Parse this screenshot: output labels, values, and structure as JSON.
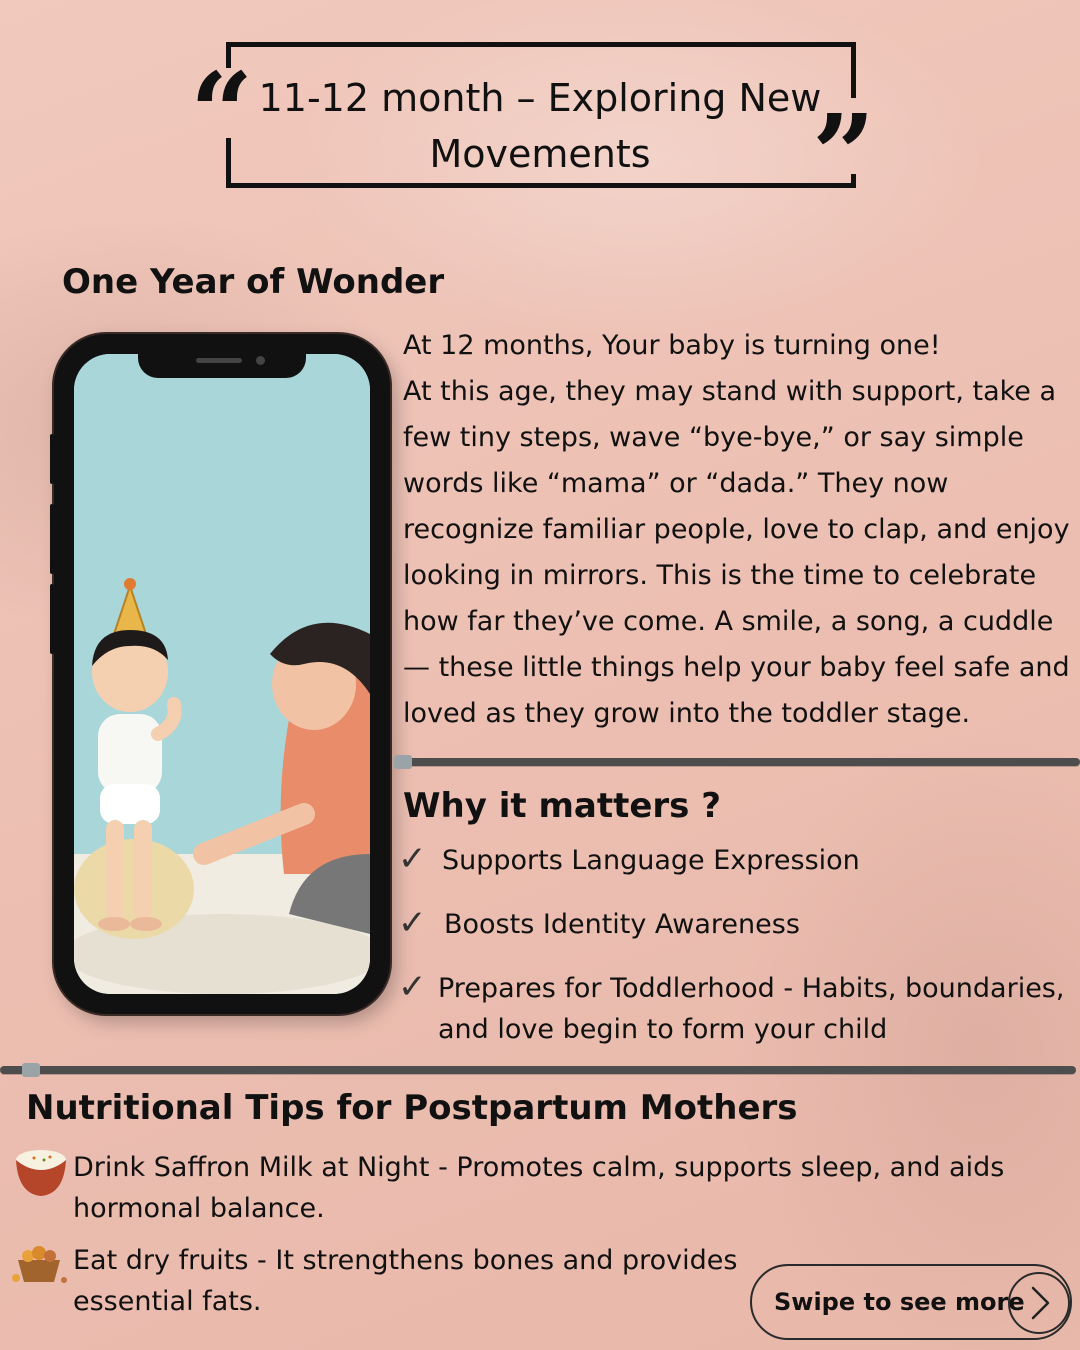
{
  "title": {
    "text": "11-12 month – Exploring New Movements"
  },
  "section_wonder": {
    "heading": "One Year of Wonder",
    "intro_line1": "At 12 months, Your baby is turning one!",
    "intro_body": "At this age, they may stand with support, take a few tiny steps, wave “bye-bye,” or say simple words like “mama” or “dada.” They now recognize familiar people, love to clap, and enjoy looking in mirrors. This is the time to celebrate how far they’ve come. A smile, a song, a cuddle — these little things help your baby feel safe and loved as they grow into the toddler stage."
  },
  "section_why": {
    "heading": "Why it matters ?",
    "items": [
      "Supports Language Expression",
      "Boosts Identity Awareness",
      "Prepares for Toddlerhood - Habits, boundaries, and love begin to form your child"
    ]
  },
  "section_nutrition": {
    "heading": "Nutritional Tips for Postpartum Mothers",
    "items": [
      {
        "text": "Drink Saffron Milk at Night - Promotes calm, supports sleep, and aids hormonal balance.",
        "icon": "saffron-milk-bowl-icon"
      },
      {
        "text": "Eat dry fruits - It strengthens bones and provides essential fats.",
        "icon": "dry-fruits-basket-icon"
      }
    ]
  },
  "swipe": {
    "label": "Swipe to see more",
    "icon": "chevron-right-icon"
  },
  "colors": {
    "background": "#ecbfb2",
    "text": "#111111",
    "divider": "#4d4d4d",
    "phone_screen": "#a9d6d8"
  }
}
